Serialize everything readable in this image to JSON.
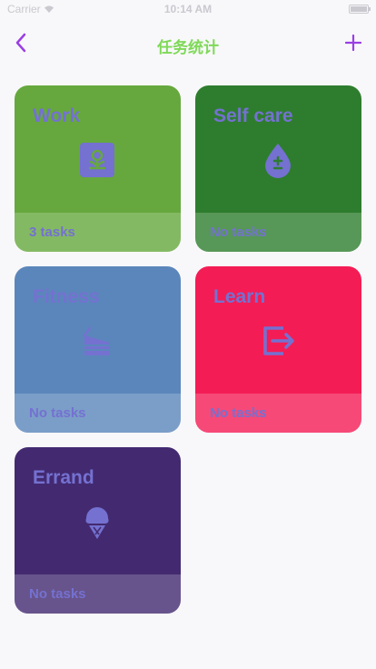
{
  "status": {
    "carrier": "Carrier",
    "time": "10:14 AM"
  },
  "nav": {
    "title": "任务统计",
    "back_icon": "chevron-left-icon",
    "add_icon": "plus-icon",
    "accent": "#9a3fe3",
    "title_color": "#7ed957"
  },
  "theme": {
    "text_color": "#7471d1"
  },
  "categories": [
    {
      "name": "Work",
      "count": "3 tasks",
      "color": "#66a83d",
      "icon": "flower-pot-icon"
    },
    {
      "name": "Self care",
      "count": "No tasks",
      "color": "#2e7d2e",
      "icon": "drop-plus-minus-icon"
    },
    {
      "name": "Fitness",
      "count": "No tasks",
      "color": "#5b86bb",
      "icon": "cake-icon"
    },
    {
      "name": "Learn",
      "count": "No tasks",
      "color": "#f41c55",
      "icon": "exit-icon"
    },
    {
      "name": "Errand",
      "count": "No tasks",
      "color": "#432a70",
      "icon": "ice-cream-icon"
    }
  ]
}
